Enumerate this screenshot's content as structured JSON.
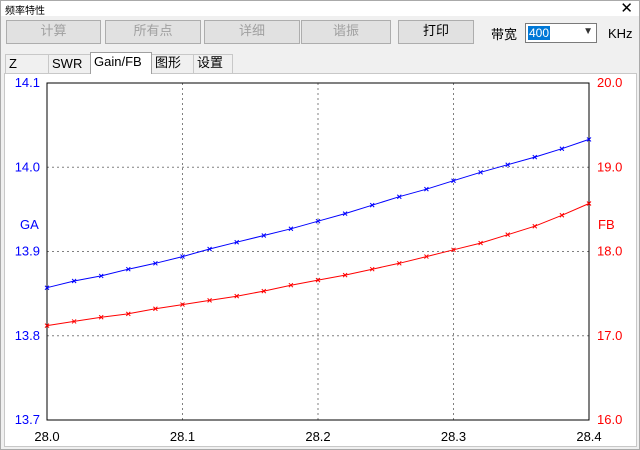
{
  "window": {
    "title": "频率特性",
    "close_glyph": "✕"
  },
  "toolbar": {
    "buttons": [
      {
        "label": "计算",
        "enabled": false
      },
      {
        "label": "所有点",
        "enabled": false
      },
      {
        "label": "详细",
        "enabled": false
      },
      {
        "label": "谐振",
        "enabled": false
      },
      {
        "label": "打印",
        "enabled": true
      }
    ],
    "bandwidth_label": "带宽",
    "bandwidth_value": "400",
    "bandwidth_unit": "KHz"
  },
  "tabs": [
    {
      "label": "Z",
      "active": false
    },
    {
      "label": "SWR",
      "active": false
    },
    {
      "label": "Gain/FB",
      "active": true
    },
    {
      "label": "图形",
      "active": false
    },
    {
      "label": "设置",
      "active": false
    }
  ],
  "colors": {
    "ga": "#0000ff",
    "fb": "#ff0000",
    "grid": "#808080",
    "axis": "#000000"
  },
  "chart_data": {
    "type": "line",
    "x": [
      28.0,
      28.02,
      28.04,
      28.06,
      28.08,
      28.1,
      28.12,
      28.14,
      28.16,
      28.18,
      28.2,
      28.22,
      28.24,
      28.26,
      28.28,
      28.3,
      28.32,
      28.34,
      28.36,
      28.38,
      28.4
    ],
    "xlim": [
      28.0,
      28.4
    ],
    "x_ticks": [
      "28.0",
      "28.1",
      "28.2",
      "28.3",
      "28.4"
    ],
    "grid": true,
    "series": [
      {
        "name": "GA",
        "axis": "left",
        "ylim": [
          13.7,
          14.1
        ],
        "y_ticks": [
          "14.1",
          "14.0",
          "13.9",
          "13.8",
          "13.7"
        ],
        "values": [
          13.857,
          13.865,
          13.871,
          13.879,
          13.886,
          13.894,
          13.903,
          13.911,
          13.919,
          13.927,
          13.936,
          13.945,
          13.955,
          13.965,
          13.974,
          13.984,
          13.994,
          14.003,
          14.012,
          14.022,
          14.033
        ]
      },
      {
        "name": "FB",
        "axis": "right",
        "ylim": [
          16.0,
          20.0
        ],
        "y_ticks": [
          "20.0",
          "19.0",
          "18.0",
          "17.0",
          "16.0"
        ],
        "values": [
          17.12,
          17.17,
          17.22,
          17.26,
          17.32,
          17.37,
          17.42,
          17.47,
          17.53,
          17.6,
          17.66,
          17.72,
          17.79,
          17.86,
          17.94,
          18.02,
          18.1,
          18.2,
          18.3,
          18.43,
          18.57
        ]
      }
    ]
  }
}
